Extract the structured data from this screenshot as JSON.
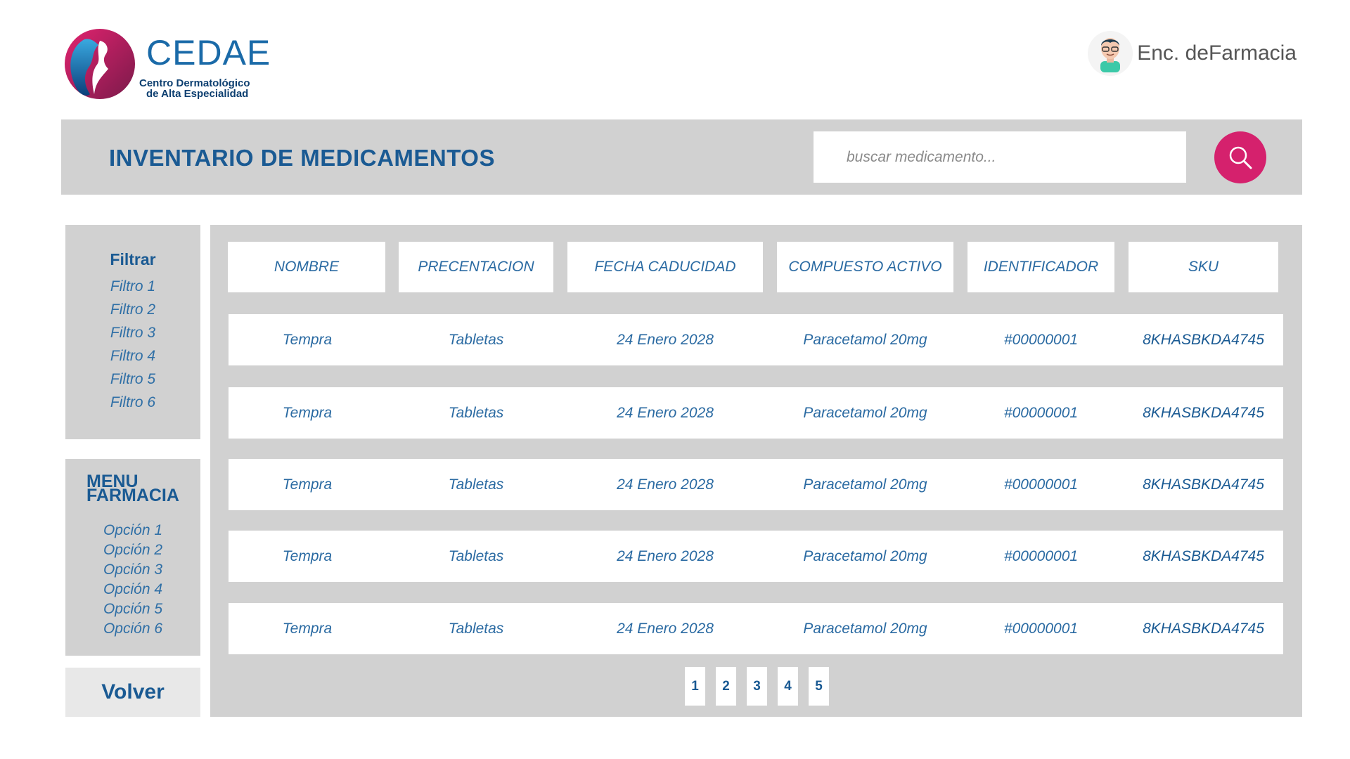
{
  "brand": {
    "name": "CEDAE",
    "subtitle_line1": "Centro Dermatológico",
    "subtitle_line2": "de Alta Especialidad",
    "colors": {
      "primary": "#1a6aa8",
      "accent": "#d5216d",
      "panel": "#d1d1d1"
    }
  },
  "user": {
    "name": "Enc. deFarmacia",
    "icon": "user-avatar-icon"
  },
  "header": {
    "title": "INVENTARIO DE MEDICAMENTOS"
  },
  "search": {
    "placeholder": "buscar medicamento...",
    "icon": "search-icon"
  },
  "filters": {
    "heading": "Filtrar",
    "items": [
      "Filtro 1",
      "Filtro 2",
      "Filtro 3",
      "Filtro 4",
      "Filtro 5",
      "Filtro 6"
    ]
  },
  "menu": {
    "heading_line1": "MENU",
    "heading_line2": "FARMACIA",
    "items": [
      "Opción 1",
      "Opción 2",
      "Opción 3",
      "Opción 4",
      "Opción 5",
      "Opción 6"
    ]
  },
  "back_label": "Volver",
  "table": {
    "columns": [
      "NOMBRE",
      "PRECENTACION",
      "FECHA CADUCIDAD",
      "COMPUESTO ACTIVO",
      "IDENTIFICADOR",
      "SKU"
    ],
    "rows": [
      [
        "Tempra",
        "Tabletas",
        "24 Enero 2028",
        "Paracetamol 20mg",
        "#00000001",
        "8KHASBKDA4745"
      ],
      [
        "Tempra",
        "Tabletas",
        "24 Enero 2028",
        "Paracetamol 20mg",
        "#00000001",
        "8KHASBKDA4745"
      ],
      [
        "Tempra",
        "Tabletas",
        "24 Enero 2028",
        "Paracetamol 20mg",
        "#00000001",
        "8KHASBKDA4745"
      ],
      [
        "Tempra",
        "Tabletas",
        "24 Enero 2028",
        "Paracetamol 20mg",
        "#00000001",
        "8KHASBKDA4745"
      ],
      [
        "Tempra",
        "Tabletas",
        "24 Enero 2028",
        "Paracetamol 20mg",
        "#00000001",
        "8KHASBKDA4745"
      ]
    ]
  },
  "pagination": [
    "1",
    "2",
    "3",
    "4",
    "5"
  ]
}
